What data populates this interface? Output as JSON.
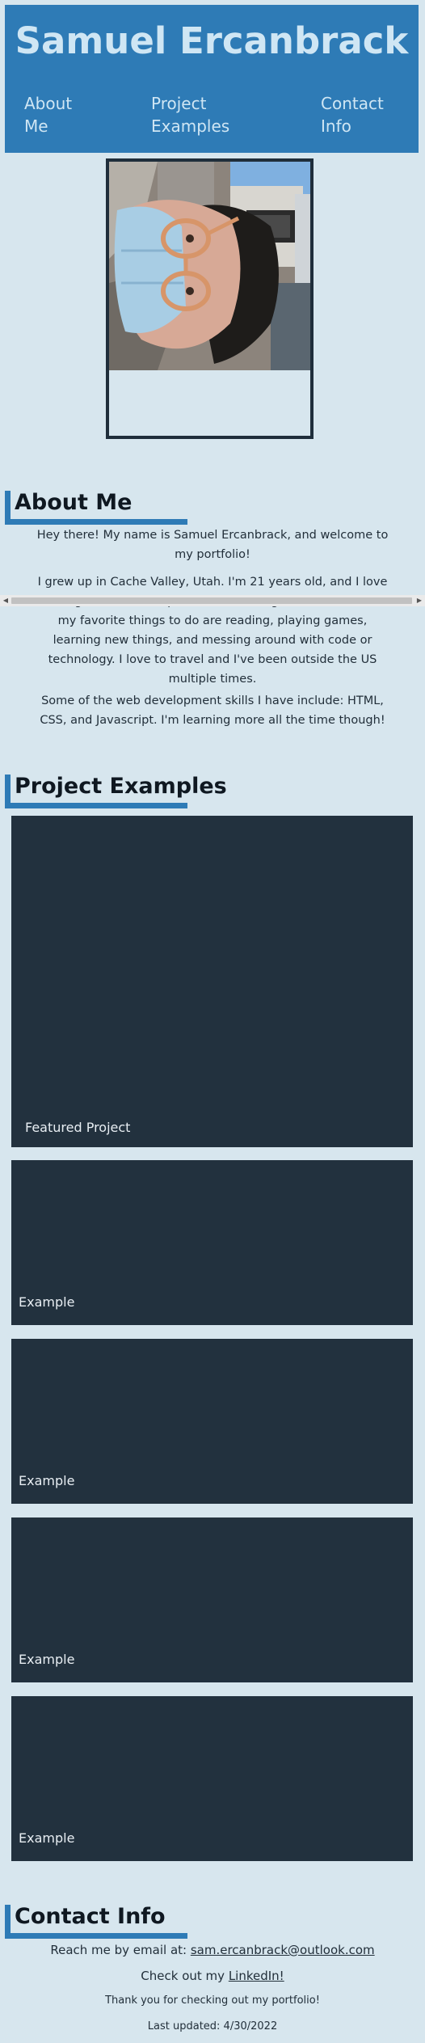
{
  "header": {
    "title": "Samuel Ercanbrack",
    "nav": {
      "about": "About\nMe",
      "projects": "Project\nExamples",
      "contact": "Contact\nInfo"
    },
    "colors": {
      "background": "#2e7bb6",
      "text": "#cfe6f4"
    }
  },
  "about": {
    "heading": "About Me",
    "paragraphs": [
      "Hey there! My name is Samuel Ercanbrack, and welcome to my portfolio!",
      "I grew up in Cache Valley, Utah. I'm 21 years old, and I love working in web development and making websites. Some of my favorite things to do are reading, playing games, learning new things, and messing around with code or technology. I love to travel and I've been outside the US multiple times.",
      "Some of the web development skills I have include: HTML, CSS, and Javascript. I'm learning more all the time though!"
    ]
  },
  "projects": {
    "heading": "Project Examples",
    "featured_label": "Featured Project",
    "example_labels": [
      "Example",
      "Example",
      "Example",
      "Example"
    ]
  },
  "contact": {
    "heading": "Contact Info",
    "email_prefix": "Reach me by email at: ",
    "email": "sam.ercanbrack@outlook.com",
    "linkedin_prefix": "Check out my ",
    "linkedin_label": "LinkedIn!",
    "thanks": "Thank you for checking out my portfolio!",
    "last_updated": "Last updated: 4/30/2022"
  },
  "theme": {
    "page_background": "#d7e6ee",
    "accent": "#2e7bb6",
    "card_background": "#22313e",
    "text": "#222f3a"
  }
}
